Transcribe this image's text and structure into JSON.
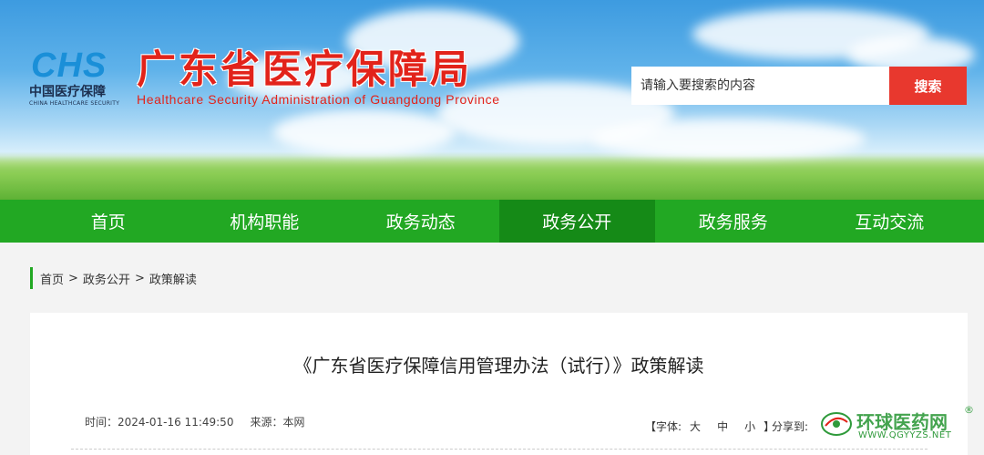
{
  "header": {
    "logo": {
      "mark": "CHS",
      "cn": "中国医疗保障",
      "en": "CHINA HEALTHCARE SECURITY"
    },
    "title": "广东省医疗保障局",
    "subtitle": "Healthcare Security Administration of Guangdong Province"
  },
  "search": {
    "placeholder": "请输入要搜索的内容",
    "button_label": "搜索"
  },
  "nav": {
    "items": [
      {
        "label": "首页"
      },
      {
        "label": "机构职能"
      },
      {
        "label": "政务动态"
      },
      {
        "label": "政务公开",
        "active": true
      },
      {
        "label": "政务服务"
      },
      {
        "label": "互动交流"
      }
    ]
  },
  "breadcrumb": {
    "items": [
      "首页",
      "政务公开",
      "政策解读"
    ],
    "separator": ">"
  },
  "article": {
    "title": "《广东省医疗保障信用管理办法（试行）》政策解读",
    "time": "时间：2024-01-16 11:49:50",
    "source": "来源：本网",
    "font_size": {
      "open": "【字体:",
      "large": "大",
      "medium": "中",
      "small": "小",
      "close": "】"
    },
    "share_label": "分享到:"
  },
  "watermark": {
    "name": "环球医药网",
    "reg": "®",
    "url": "WWW.QGYYZS.NET"
  },
  "colors": {
    "brand_red": "#e2231a",
    "nav_green": "#22a823",
    "nav_active": "#158a17",
    "search_button": "#e8382e"
  }
}
